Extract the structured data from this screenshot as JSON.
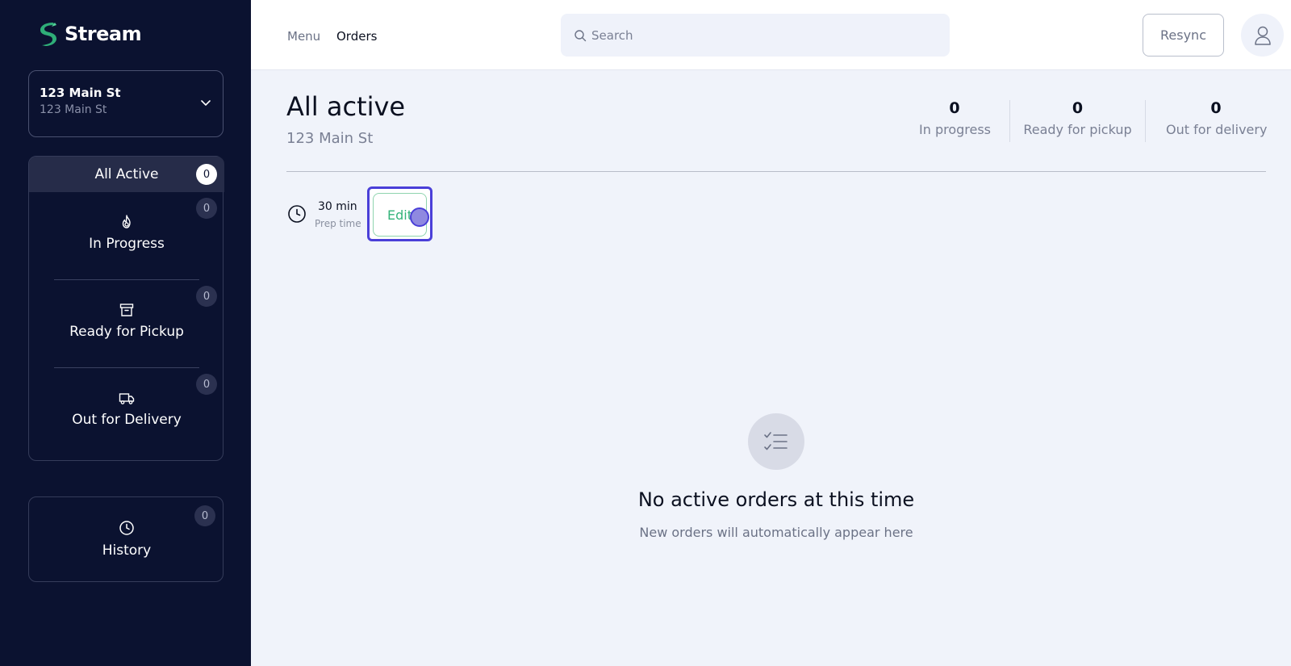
{
  "app": {
    "name": "Stream"
  },
  "location": {
    "name": "123 Main St",
    "address": "123 Main St"
  },
  "sidebar": {
    "active_item": {
      "label": "All Active",
      "count": "0"
    },
    "items": [
      {
        "label": "In Progress",
        "count": "0",
        "icon": "flame-icon"
      },
      {
        "label": "Ready for Pickup",
        "count": "0",
        "icon": "archive-box-icon"
      },
      {
        "label": "Out for Delivery",
        "count": "0",
        "icon": "truck-icon"
      }
    ],
    "history": {
      "label": "History",
      "count": "0",
      "icon": "clock-icon"
    }
  },
  "header": {
    "nav": [
      {
        "label": "Menu"
      },
      {
        "label": "Orders"
      }
    ],
    "search": {
      "placeholder": "Search",
      "value": ""
    },
    "resync_label": "Resync"
  },
  "main": {
    "title": "All active",
    "subtitle": "123 Main St",
    "stats": [
      {
        "value": "0",
        "label": "In progress"
      },
      {
        "value": "0",
        "label": "Ready for pickup"
      },
      {
        "value": "0",
        "label": "Out for delivery"
      }
    ],
    "prep": {
      "value": "30 min",
      "label": "Prep time",
      "edit_label": "Edit"
    },
    "empty": {
      "title": "No active orders at this time",
      "subtitle": "New orders will automatically appear here"
    }
  },
  "colors": {
    "sidebar_bg": "#0b1230",
    "brand_green": "#34b37a",
    "focus_ring": "#4a3fd8",
    "page_bg": "#f0f3fa"
  }
}
